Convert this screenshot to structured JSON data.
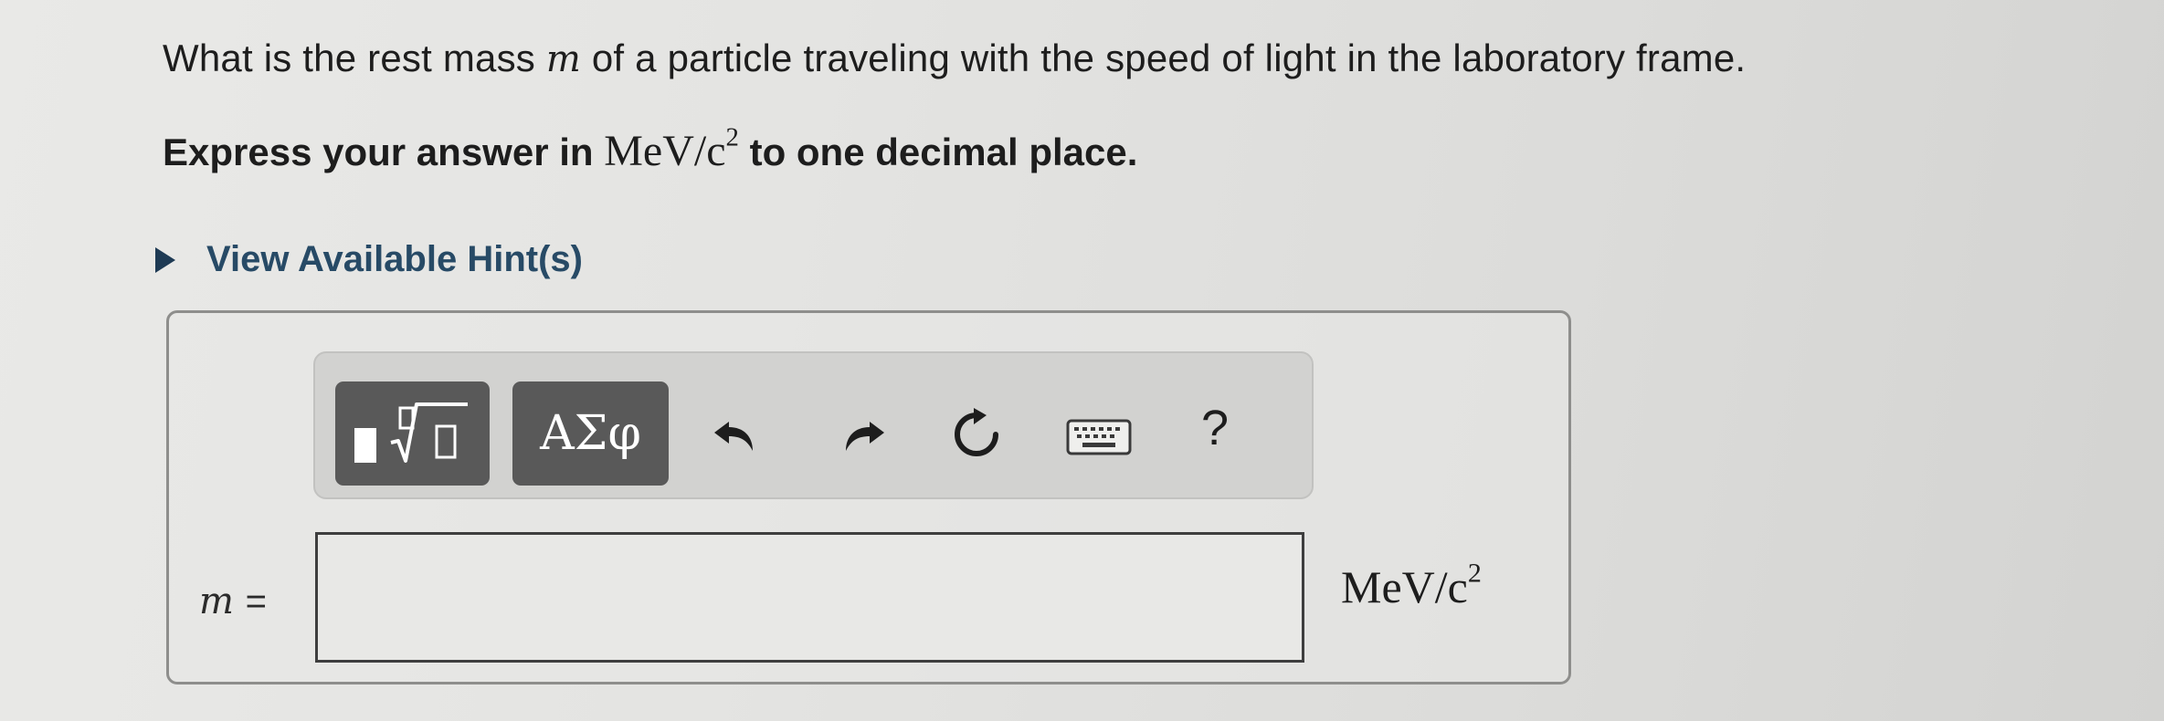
{
  "question": {
    "text_before": "What is the rest mass ",
    "variable": "m",
    "text_after": " of a particle traveling with the speed of light in the laboratory frame."
  },
  "instruction": {
    "text_before": "Express your answer in ",
    "unit": "MeV/c",
    "unit_exponent": "2",
    "text_after": " to one decimal place."
  },
  "hint": {
    "label": "View Available Hint(s)",
    "icon": "triangle-right-icon"
  },
  "toolbar": {
    "templates_icon": "math-templates-icon",
    "greek_label": "ΑΣφ",
    "undo_icon": "undo-icon",
    "redo_icon": "redo-icon",
    "reset_icon": "reset-icon",
    "keyboard_icon": "keyboard-icon",
    "help_label": "?"
  },
  "answer": {
    "variable": "m",
    "equals": "=",
    "value": "",
    "unit": "MeV/c",
    "unit_exponent": "2"
  }
}
